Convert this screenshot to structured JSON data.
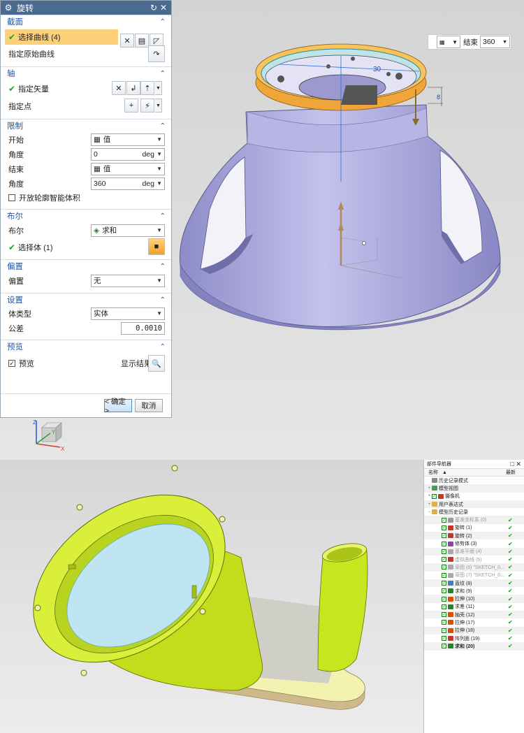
{
  "dialog": {
    "title": "旋转",
    "sections": {
      "section": {
        "header": "截面",
        "select_curve": "选择曲线 (4)",
        "specify_original_curve": "指定原始曲线"
      },
      "axis": {
        "header": "轴",
        "specify_vector": "指定矢量",
        "specify_point": "指定点"
      },
      "limits": {
        "header": "限制",
        "start_label": "开始",
        "start_value": "值",
        "start_angle_label": "角度",
        "start_angle": "0",
        "end_label": "结束",
        "end_value": "值",
        "end_angle_label": "角度",
        "end_angle": "360",
        "unit": "deg",
        "open_profile": "开放轮廓智能体积"
      },
      "boolean": {
        "header": "布尔",
        "boolean_label": "布尔",
        "boolean_value": "求和",
        "select_body": "选择体 (1)"
      },
      "offset": {
        "header": "偏置",
        "offset_label": "偏置",
        "offset_value": "无"
      },
      "settings": {
        "header": "设置",
        "body_type_label": "体类型",
        "body_type_value": "实体",
        "tolerance_label": "公差",
        "tolerance_value": "0.0010"
      },
      "preview": {
        "header": "预览",
        "preview_label": "预览",
        "show_result": "显示结果"
      }
    },
    "ok_label": "< 确定 >",
    "cancel_label": "取消"
  },
  "float_toolbar": {
    "end_label": "结束",
    "end_value": "360"
  },
  "model_dims": {
    "dim1": "30",
    "dim2": "8"
  },
  "triad": {
    "x": "X",
    "y": "Y",
    "z": "Z"
  },
  "navigator": {
    "title": "部件导航器",
    "col_name": "名称",
    "col_latest": "最新",
    "items": [
      {
        "text": "历史记录模式",
        "level": 0,
        "toggle": "",
        "check": false,
        "icon": "#888",
        "dim": false,
        "ok": false,
        "bold": false
      },
      {
        "text": "模型视图",
        "level": 0,
        "toggle": "+",
        "check": false,
        "icon": "#4a9d4a",
        "dim": false,
        "ok": false,
        "bold": false
      },
      {
        "text": "摄像机",
        "level": 0,
        "toggle": "+",
        "check": true,
        "icon": "#c0392b",
        "dim": false,
        "ok": false,
        "bold": false
      },
      {
        "text": "用户表达式",
        "level": 0,
        "toggle": "+",
        "check": false,
        "icon": "#e0b040",
        "dim": false,
        "ok": false,
        "bold": false
      },
      {
        "text": "模型历史记录",
        "level": 0,
        "toggle": "−",
        "check": false,
        "icon": "#e0b040",
        "dim": false,
        "ok": false,
        "bold": false
      },
      {
        "text": "基准坐标系 (0)",
        "level": 1,
        "toggle": "",
        "check": true,
        "icon": "#999",
        "dim": true,
        "ok": true,
        "bold": false
      },
      {
        "text": "旋转 (1)",
        "level": 1,
        "toggle": "",
        "check": true,
        "icon": "#c0392b",
        "dim": false,
        "ok": true,
        "bold": false
      },
      {
        "text": "旋转 (2)",
        "level": 1,
        "toggle": "",
        "check": true,
        "icon": "#c0392b",
        "dim": false,
        "ok": true,
        "bold": false
      },
      {
        "text": "修剪体 (3)",
        "level": 1,
        "toggle": "",
        "check": true,
        "icon": "#8e44ad",
        "dim": false,
        "ok": true,
        "bold": false
      },
      {
        "text": "基准平面 (4)",
        "level": 1,
        "toggle": "",
        "check": true,
        "icon": "#aaa",
        "dim": true,
        "ok": true,
        "bold": false
      },
      {
        "text": "虚拟曲线 (5)",
        "level": 1,
        "toggle": "",
        "check": true,
        "icon": "#c0392b",
        "dim": true,
        "ok": true,
        "bold": false
      },
      {
        "text": "草图 (6) \"SKETCH_0...",
        "level": 1,
        "toggle": "",
        "check": true,
        "icon": "#aaa",
        "dim": true,
        "ok": true,
        "bold": false
      },
      {
        "text": "草图 (7) \"SKETCH_0...",
        "level": 1,
        "toggle": "",
        "check": true,
        "icon": "#aaa",
        "dim": true,
        "ok": true,
        "bold": false
      },
      {
        "text": "直纹 (8)",
        "level": 1,
        "toggle": "",
        "check": true,
        "icon": "#3f7fbf",
        "dim": false,
        "ok": true,
        "bold": false
      },
      {
        "text": "求和 (9)",
        "level": 1,
        "toggle": "",
        "check": true,
        "icon": "#2e7d32",
        "dim": false,
        "ok": true,
        "bold": false
      },
      {
        "text": "拉伸 (10)",
        "level": 1,
        "toggle": "",
        "check": true,
        "icon": "#d35400",
        "dim": false,
        "ok": true,
        "bold": false
      },
      {
        "text": "求差 (11)",
        "level": 1,
        "toggle": "",
        "check": true,
        "icon": "#2e7d32",
        "dim": false,
        "ok": true,
        "bold": false
      },
      {
        "text": "抽壳 (12)",
        "level": 1,
        "toggle": "",
        "check": true,
        "icon": "#d35400",
        "dim": false,
        "ok": true,
        "bold": false
      },
      {
        "text": "拉伸 (17)",
        "level": 1,
        "toggle": "",
        "check": true,
        "icon": "#d35400",
        "dim": false,
        "ok": true,
        "bold": false
      },
      {
        "text": "拉伸 (18)",
        "level": 1,
        "toggle": "",
        "check": true,
        "icon": "#d35400",
        "dim": false,
        "ok": true,
        "bold": false
      },
      {
        "text": "阵列面 (19)",
        "level": 1,
        "toggle": "",
        "check": true,
        "icon": "#c0392b",
        "dim": false,
        "ok": true,
        "bold": false
      },
      {
        "text": "求和 (20)",
        "level": 1,
        "toggle": "",
        "check": true,
        "icon": "#2e7d32",
        "dim": false,
        "ok": true,
        "bold": true
      }
    ]
  }
}
